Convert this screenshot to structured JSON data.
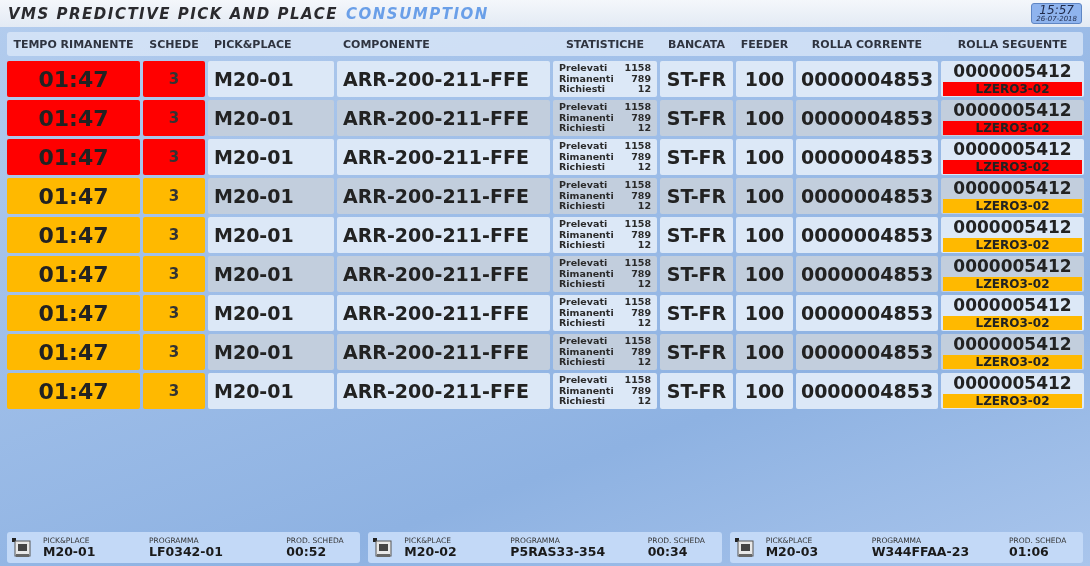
{
  "header": {
    "title": "VMS PREDICTIVE PICK AND PLACE",
    "subtitle": "CONSUMPTION",
    "clock": {
      "time": "15:57",
      "date": "26-07-2018"
    }
  },
  "table": {
    "columns": [
      "TEMPO RIMANENTE",
      "SCHEDE",
      "PICK&PLACE",
      "COMPONENTE",
      "STATISTICHE",
      "BANCATA",
      "FEEDER",
      "ROLLA CORRENTE",
      "ROLLA SEGUENTE"
    ],
    "rows": [
      {
        "color": "#ff0000",
        "time": "01:47",
        "boards": "3",
        "machine": "M20-01",
        "component": "ARR-200-211-FFE",
        "stats": [
          {
            "label": "Prelevati",
            "value": "1158"
          },
          {
            "label": "Rimanenti",
            "value": "789"
          },
          {
            "label": "Richiesti",
            "value": "12"
          }
        ],
        "bank": "ST-FR",
        "feeder": "100",
        "current_reel": "0000004853",
        "next_reel": "0000005412",
        "next_location": "LZERO3-02"
      },
      {
        "color": "#ff0000",
        "time": "01:47",
        "boards": "3",
        "machine": "M20-01",
        "component": "ARR-200-211-FFE",
        "stats": [
          {
            "label": "Prelevati",
            "value": "1158"
          },
          {
            "label": "Rimanenti",
            "value": "789"
          },
          {
            "label": "Richiesti",
            "value": "12"
          }
        ],
        "bank": "ST-FR",
        "feeder": "100",
        "current_reel": "0000004853",
        "next_reel": "0000005412",
        "next_location": "LZERO3-02"
      },
      {
        "color": "#ff0000",
        "time": "01:47",
        "boards": "3",
        "machine": "M20-01",
        "component": "ARR-200-211-FFE",
        "stats": [
          {
            "label": "Prelevati",
            "value": "1158"
          },
          {
            "label": "Rimanenti",
            "value": "789"
          },
          {
            "label": "Richiesti",
            "value": "12"
          }
        ],
        "bank": "ST-FR",
        "feeder": "100",
        "current_reel": "0000004853",
        "next_reel": "0000005412",
        "next_location": "LZERO3-02"
      },
      {
        "color": "#ffb900",
        "time": "01:47",
        "boards": "3",
        "machine": "M20-01",
        "component": "ARR-200-211-FFE",
        "stats": [
          {
            "label": "Prelevati",
            "value": "1158"
          },
          {
            "label": "Rimanenti",
            "value": "789"
          },
          {
            "label": "Richiesti",
            "value": "12"
          }
        ],
        "bank": "ST-FR",
        "feeder": "100",
        "current_reel": "0000004853",
        "next_reel": "0000005412",
        "next_location": "LZERO3-02"
      },
      {
        "color": "#ffb900",
        "time": "01:47",
        "boards": "3",
        "machine": "M20-01",
        "component": "ARR-200-211-FFE",
        "stats": [
          {
            "label": "Prelevati",
            "value": "1158"
          },
          {
            "label": "Rimanenti",
            "value": "789"
          },
          {
            "label": "Richiesti",
            "value": "12"
          }
        ],
        "bank": "ST-FR",
        "feeder": "100",
        "current_reel": "0000004853",
        "next_reel": "0000005412",
        "next_location": "LZERO3-02"
      },
      {
        "color": "#ffb900",
        "time": "01:47",
        "boards": "3",
        "machine": "M20-01",
        "component": "ARR-200-211-FFE",
        "stats": [
          {
            "label": "Prelevati",
            "value": "1158"
          },
          {
            "label": "Rimanenti",
            "value": "789"
          },
          {
            "label": "Richiesti",
            "value": "12"
          }
        ],
        "bank": "ST-FR",
        "feeder": "100",
        "current_reel": "0000004853",
        "next_reel": "0000005412",
        "next_location": "LZERO3-02"
      },
      {
        "color": "#ffb900",
        "time": "01:47",
        "boards": "3",
        "machine": "M20-01",
        "component": "ARR-200-211-FFE",
        "stats": [
          {
            "label": "Prelevati",
            "value": "1158"
          },
          {
            "label": "Rimanenti",
            "value": "789"
          },
          {
            "label": "Richiesti",
            "value": "12"
          }
        ],
        "bank": "ST-FR",
        "feeder": "100",
        "current_reel": "0000004853",
        "next_reel": "0000005412",
        "next_location": "LZERO3-02"
      },
      {
        "color": "#ffb900",
        "time": "01:47",
        "boards": "3",
        "machine": "M20-01",
        "component": "ARR-200-211-FFE",
        "stats": [
          {
            "label": "Prelevati",
            "value": "1158"
          },
          {
            "label": "Rimanenti",
            "value": "789"
          },
          {
            "label": "Richiesti",
            "value": "12"
          }
        ],
        "bank": "ST-FR",
        "feeder": "100",
        "current_reel": "0000004853",
        "next_reel": "0000005412",
        "next_location": "LZERO3-02"
      },
      {
        "color": "#ffb900",
        "time": "01:47",
        "boards": "3",
        "machine": "M20-01",
        "component": "ARR-200-211-FFE",
        "stats": [
          {
            "label": "Prelevati",
            "value": "1158"
          },
          {
            "label": "Rimanenti",
            "value": "789"
          },
          {
            "label": "Richiesti",
            "value": "12"
          }
        ],
        "bank": "ST-FR",
        "feeder": "100",
        "current_reel": "0000004853",
        "next_reel": "0000005412",
        "next_location": "LZERO3-02"
      }
    ]
  },
  "footer": [
    {
      "machine_label": "PICK&PLACE",
      "machine": "M20-01",
      "program_label": "PROGRAMMA",
      "program": "LF0342-01",
      "time_label": "PROD. SCHEDA",
      "time": "00:52"
    },
    {
      "machine_label": "PICK&PLACE",
      "machine": "M20-02",
      "program_label": "PROGRAMMA",
      "program": "P5RAS33-354",
      "time_label": "PROD. SCHEDA",
      "time": "00:34"
    },
    {
      "machine_label": "PICK&PLACE",
      "machine": "M20-03",
      "program_label": "PROGRAMMA",
      "program": "W344FFAA-23",
      "time_label": "PROD. SCHEDA",
      "time": "01:06"
    }
  ]
}
